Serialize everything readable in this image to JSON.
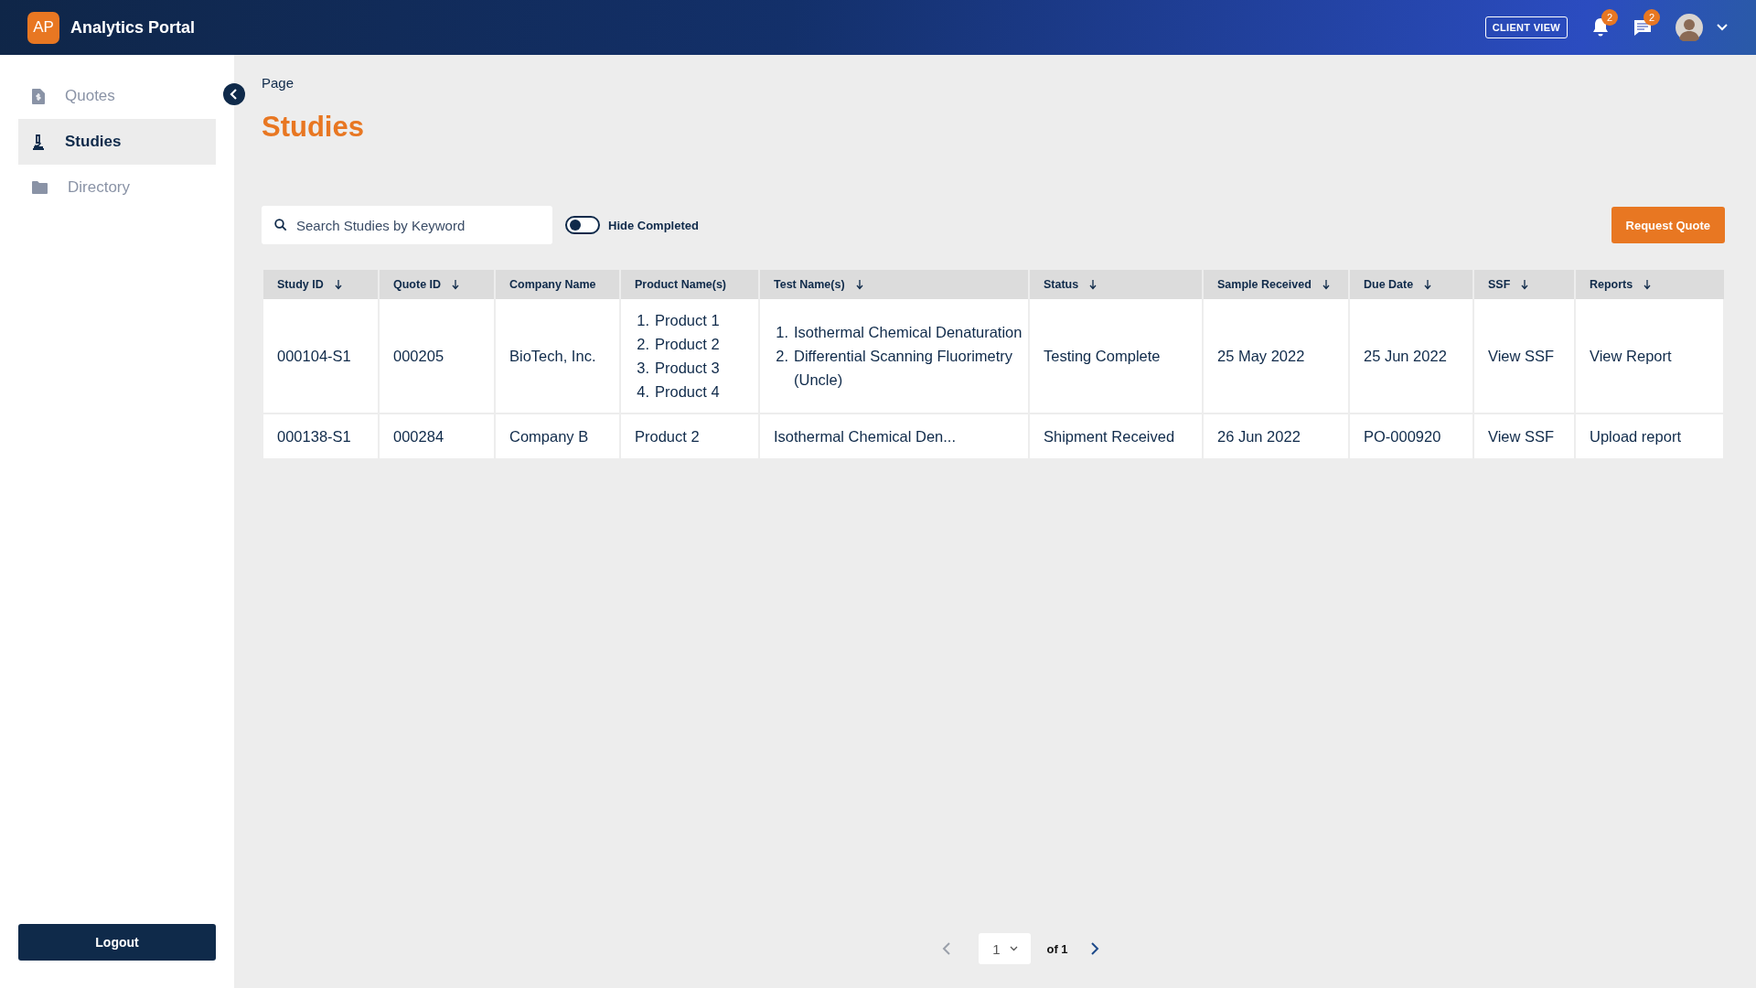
{
  "header": {
    "logo": "AP",
    "title": "Analytics Portal",
    "client_view": "CLIENT VIEW",
    "notifications": "2",
    "messages": "2"
  },
  "sidebar": {
    "items": [
      {
        "label": "Quotes",
        "selected": false
      },
      {
        "label": "Studies",
        "selected": true
      },
      {
        "label": "Directory",
        "selected": false
      }
    ],
    "logout": "Logout"
  },
  "breadcrumb": "Page",
  "page_title": "Studies",
  "search": {
    "placeholder": "Search Studies by Keyword"
  },
  "hide_completed": {
    "label": "Hide Completed",
    "on": false
  },
  "request_quote": "Request Quote",
  "table": {
    "columns": [
      {
        "label": "Study ID",
        "sortable": true
      },
      {
        "label": "Quote ID",
        "sortable": true
      },
      {
        "label": "Company Name",
        "sortable": false
      },
      {
        "label": "Product Name(s)",
        "sortable": false
      },
      {
        "label": "Test Name(s)",
        "sortable": true
      },
      {
        "label": "Status",
        "sortable": true
      },
      {
        "label": "Sample Received",
        "sortable": true
      },
      {
        "label": "Due Date",
        "sortable": true
      },
      {
        "label": "SSF",
        "sortable": true
      },
      {
        "label": "Reports",
        "sortable": true
      }
    ],
    "rows": [
      {
        "cells": [
          {
            "kind": "text",
            "text": "000104-S1"
          },
          {
            "kind": "text",
            "text": "000205"
          },
          {
            "kind": "text",
            "text": "BioTech, Inc."
          },
          {
            "kind": "list",
            "items": [
              {
                "num": "1.",
                "text": "Product 1"
              },
              {
                "num": "2.",
                "text": "Product 2"
              },
              {
                "num": "3.",
                "text": "Product 3"
              },
              {
                "num": "4.",
                "text": "Product 4"
              }
            ]
          },
          {
            "kind": "list",
            "items": [
              {
                "num": "1.",
                "text": "Isothermal Chemical Denaturation"
              },
              {
                "num": "2.",
                "text": "Differential Scanning Fluorimetry (Uncle)"
              }
            ]
          },
          {
            "kind": "text",
            "text": "Testing Complete"
          },
          {
            "kind": "text",
            "text": "25 May 2022"
          },
          {
            "kind": "text",
            "text": "25 Jun 2022"
          },
          {
            "kind": "text",
            "text": "View SSF"
          },
          {
            "kind": "text",
            "text": "View Report"
          }
        ]
      },
      {
        "cells": [
          {
            "kind": "text",
            "text": "000138-S1"
          },
          {
            "kind": "text",
            "text": "000284"
          },
          {
            "kind": "text",
            "text": "Company B"
          },
          {
            "kind": "text",
            "text": "Product 2"
          },
          {
            "kind": "text",
            "text": "Isothermal Chemical Den..."
          },
          {
            "kind": "text",
            "text": "Shipment Received"
          },
          {
            "kind": "text",
            "text": "26 Jun 2022"
          },
          {
            "kind": "text",
            "text": "PO-000920"
          },
          {
            "kind": "text",
            "text": "View SSF"
          },
          {
            "kind": "text",
            "text": "Upload report"
          }
        ]
      }
    ]
  },
  "pagination": {
    "page": "1",
    "total": "of 1",
    "prev_disabled": true,
    "next_disabled": false
  }
}
